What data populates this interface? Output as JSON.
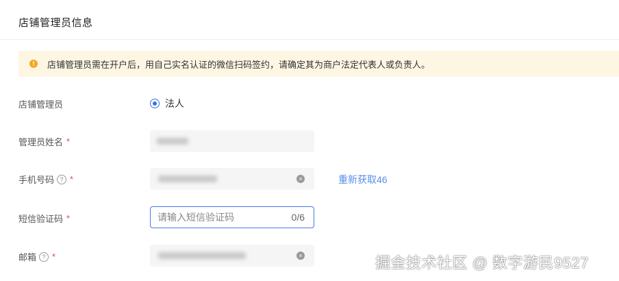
{
  "section": {
    "title": "店铺管理员信息"
  },
  "notice": {
    "icon": "exclamation-icon",
    "icon_glyph": "!",
    "text": "店铺管理员需在开户后，用自己实名认证的微信扫码签约，请确定其为商户法定代表人或负责人。"
  },
  "form": {
    "admin": {
      "label": "店铺管理员",
      "option": "法人",
      "selected": true
    },
    "name": {
      "label": "管理员姓名",
      "required_mark": "*"
    },
    "phone": {
      "label": "手机号码",
      "required_mark": "*",
      "help_glyph": "?",
      "clear_glyph": "×",
      "resend_label": "重新获取46"
    },
    "sms": {
      "label": "短信验证码",
      "required_mark": "*",
      "placeholder": "请输入短信验证码",
      "value": "",
      "counter": "0/6"
    },
    "email": {
      "label": "邮箱",
      "required_mark": "*",
      "help_glyph": "?",
      "clear_glyph": "×"
    }
  },
  "watermark": {
    "text": "掘金技术社区 @ 数字游民9527"
  },
  "colors": {
    "accent": "#3a6ee8",
    "link": "#5b8ee6",
    "required": "#e6484f",
    "notice_bg": "#fdf6e3",
    "warning": "#f5a623"
  }
}
